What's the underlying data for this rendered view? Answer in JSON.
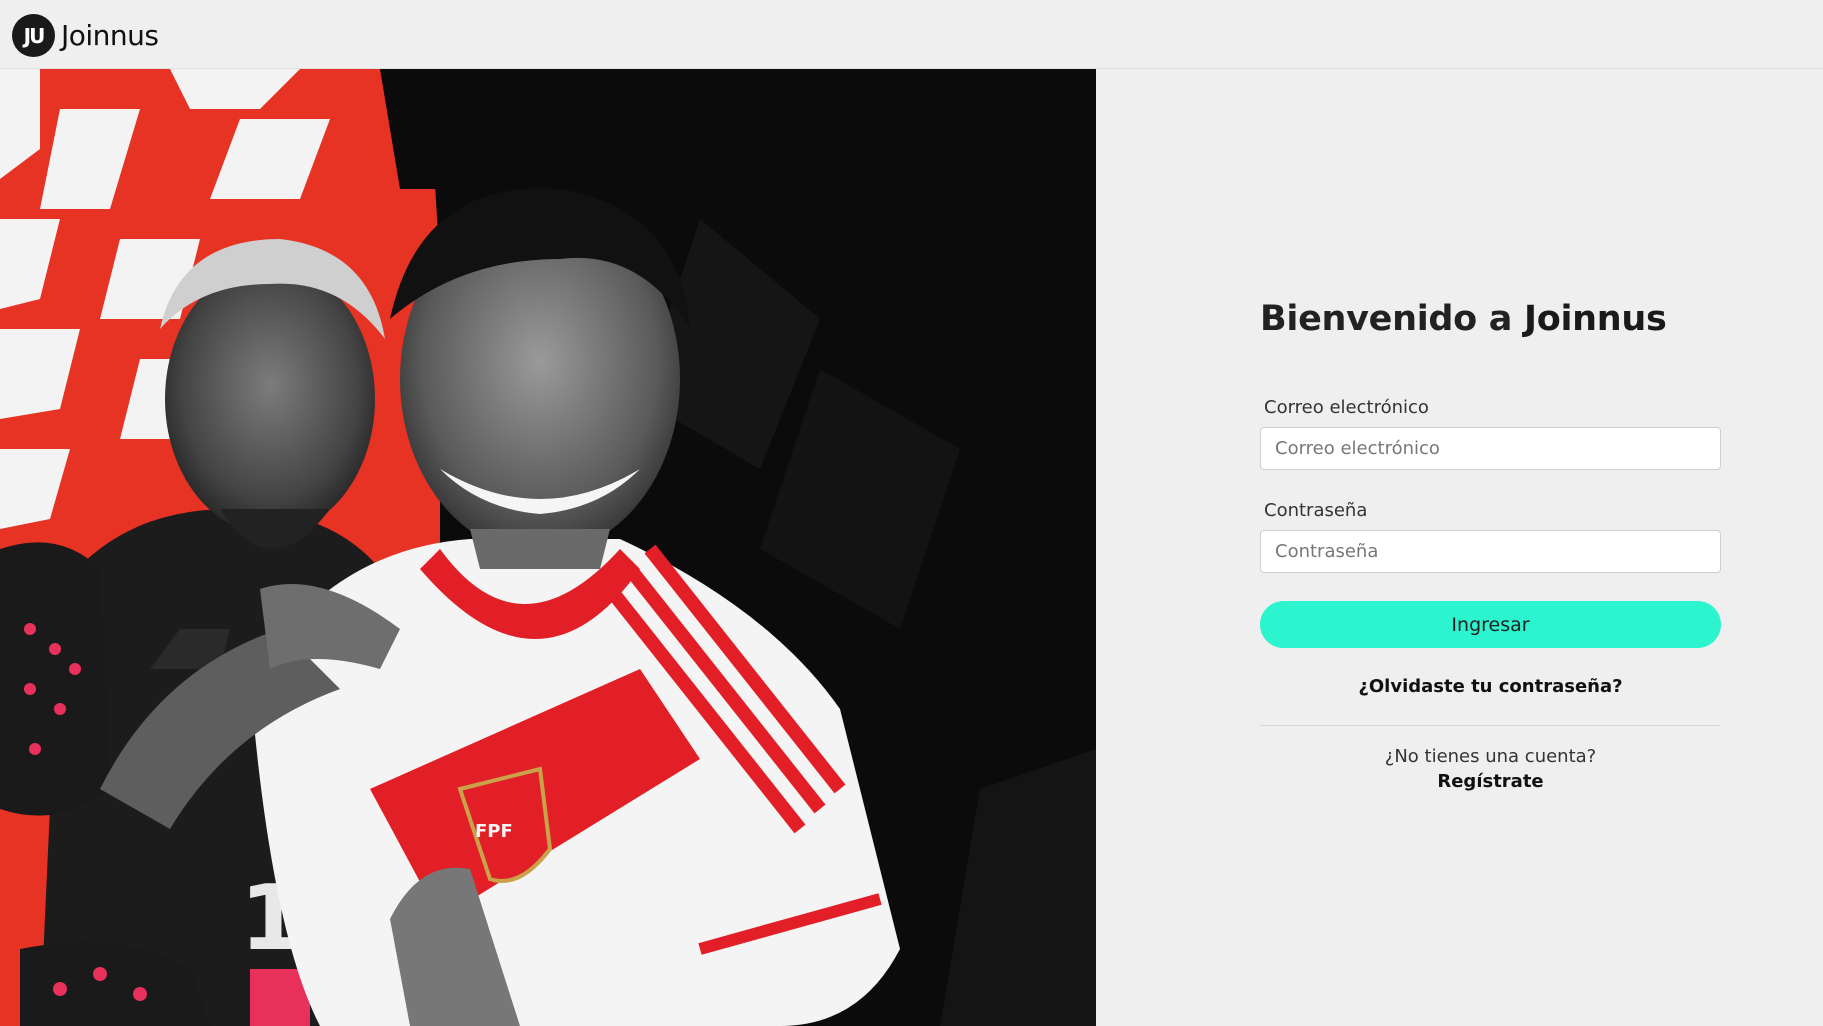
{
  "header": {
    "logo_text": "Joinnus",
    "logo_mark": "JU"
  },
  "hero": {
    "jersey_badge": "FPF",
    "jersey_number": "1"
  },
  "auth": {
    "title_prefix": "Bienvenido a ",
    "title_brand": "Joinnus",
    "email_label": "Correo electrónico",
    "email_placeholder": "Correo electrónico",
    "email_value": "",
    "password_label": "Contraseña",
    "password_placeholder": "Contraseña",
    "password_value": "",
    "login_button": "Ingresar",
    "forgot_link": "¿Olvidaste tu contraseña?",
    "no_account_text": "¿No tienes una cuenta?",
    "register_link": "Regístrate"
  },
  "colors": {
    "accent": "#2bf4cf",
    "hero_red": "#e63323",
    "hero_black": "#0b0b0b",
    "page_bg": "#efefef"
  }
}
